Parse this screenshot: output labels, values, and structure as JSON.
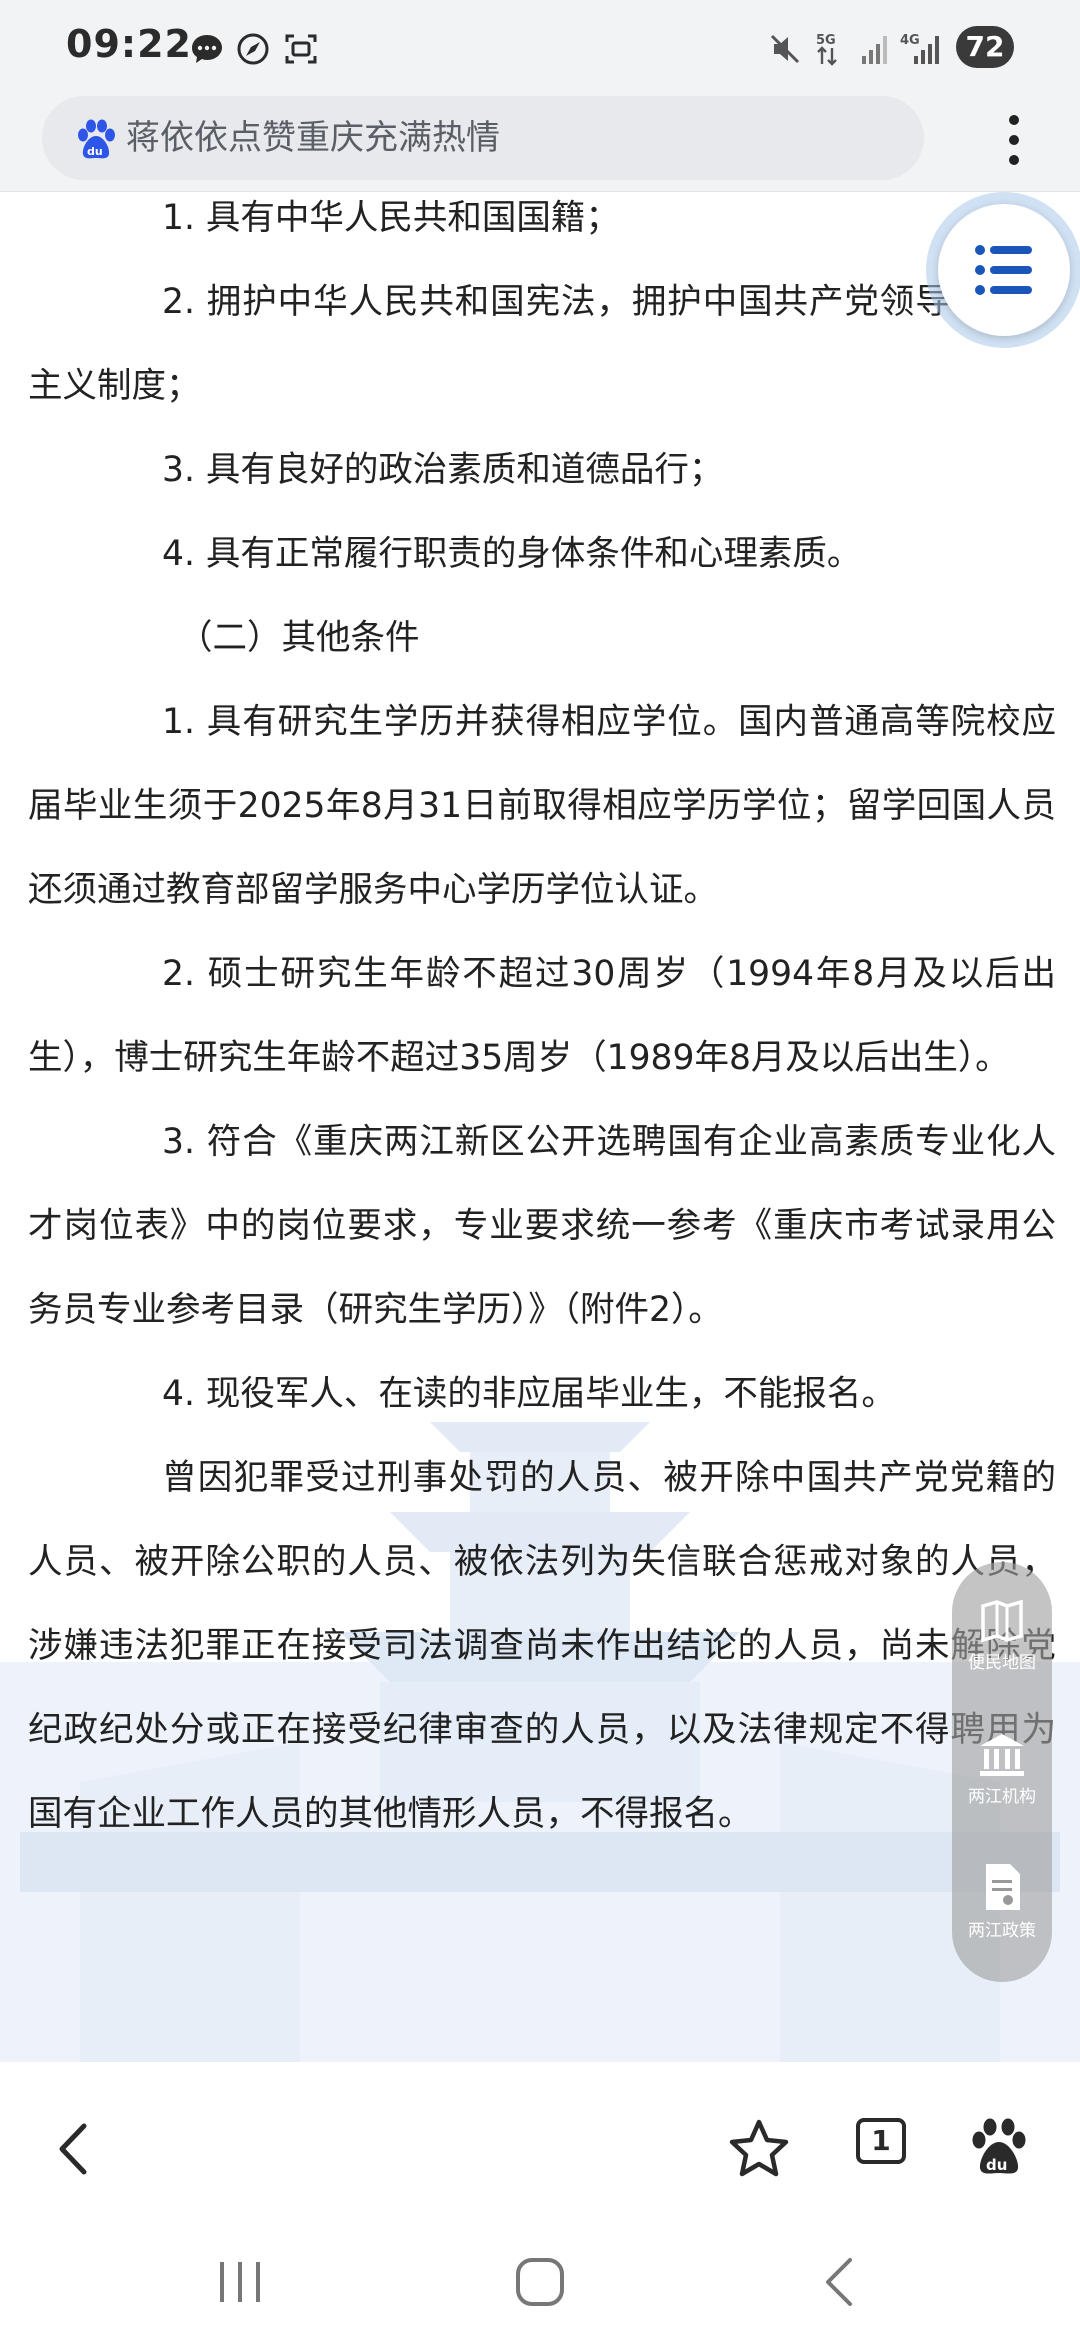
{
  "status_bar": {
    "time": "09:22",
    "network_5g": "5G",
    "network_4g": "4G",
    "battery": "72"
  },
  "search": {
    "query": "蒋依依点赞重庆充满热情"
  },
  "article": {
    "paragraphs": [
      "1. 具有中华人民共和国国籍；",
      "2. 拥护中华人民共和国宪法，拥护中国共产党领导和社会主义制度；",
      "3. 具有良好的政治素质和道德品行；",
      "4. 具有正常履行职责的身体条件和心理素质。",
      "（二）其他条件",
      "1. 具有研究生学历并获得相应学位。国内普通高等院校应届毕业生须于2025年8月31日前取得相应学历学位；留学回国人员还须通过教育部留学服务中心学历学位认证。",
      "2. 硕士研究生年龄不超过30周岁（1994年8月及以后出生），博士研究生年龄不超过35周岁（1989年8月及以后出生）。",
      "3. 符合《重庆两江新区公开选聘国有企业高素质专业化人才岗位表》中的岗位要求，专业要求统一参考《重庆市考试录用公务员专业参考目录（研究生学历）》（附件2）。",
      "4. 现役军人、在读的非应届毕业生，不能报名。",
      "曾因犯罪受过刑事处罚的人员、被开除中国共产党党籍的人员、被开除公职的人员、被依法列为失信联合惩戒对象的人员，涉嫌违法犯罪正在接受司法调查尚未作出结论的人员，尚未解除党纪政纪处分或正在接受纪律审查的人员，以及法律规定不得聘用为国有企业工作人员的其他情形人员，不得报名。"
    ]
  },
  "side_panel": {
    "items": [
      {
        "label": "便民地图",
        "icon": "map-book-icon"
      },
      {
        "label": "两江机构",
        "icon": "institution-icon"
      },
      {
        "label": "两江政策",
        "icon": "policy-document-icon"
      }
    ]
  },
  "toolbar": {
    "tab_count": "1"
  },
  "colors": {
    "fab_icon": "#1a56b8",
    "baidu_blue": "#2d55e8",
    "text": "#222222"
  }
}
